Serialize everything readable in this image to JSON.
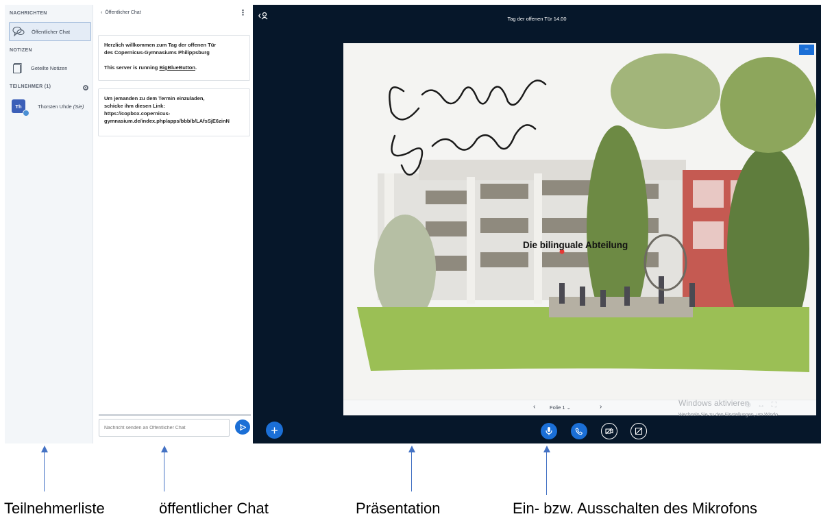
{
  "sidebar": {
    "messages_header": "NACHRICHTEN",
    "public_chat_label": "Öffentlicher Chat",
    "notes_header": "NOTIZEN",
    "shared_notes_label": "Geteilte Notizen",
    "participants_header": "TEILNEHMER (1)",
    "user": {
      "initials": "Th",
      "name": "Thorsten Uhde",
      "suffix": "(Sie)"
    }
  },
  "chat": {
    "title": "Öffentlicher Chat",
    "messages": [
      {
        "line1": "Herzlich willkommen zum Tag der offenen Tür",
        "line2": "des Copernicus-Gymnasiums Philippsburg",
        "line3_prefix": "This server is running ",
        "line3_link": "BigBlueButton",
        "line3_suffix": "."
      },
      {
        "line1": "Um jemanden zu dem Termin einzuladen,",
        "line2": "schicke ihm diesen Link:",
        "line3": "https://copbox.copernicus-",
        "line4": "gymnasium.de/index.php/apps/bbb/b/LAfsSjE6zinN"
      }
    ],
    "input_placeholder": "Nachricht senden an Öffentlicher Chat"
  },
  "presentation": {
    "meeting_title": "Tag der offenen Tür 14.00",
    "slide_caption": "Die bilinguale Abteilung",
    "slide_label": "Folie 1",
    "minimize_label": "–",
    "windows_activate": "Windows aktivieren",
    "windows_activate_sub": "Wechseln Sie zu den Einstellungen, um Windo"
  },
  "annotations": {
    "participants_list": "Teilnehmerliste",
    "public_chat": "öffentlicher Chat",
    "presentation": "Präsentation",
    "mic_toggle": "Ein- bzw. Ausschalten des Mikrofons"
  },
  "colors": {
    "accent": "#1b6fd6",
    "presentation_bg": "#06172a",
    "sidebar_bg": "#f3f6f9",
    "annotation_arrow": "#4472c4"
  }
}
